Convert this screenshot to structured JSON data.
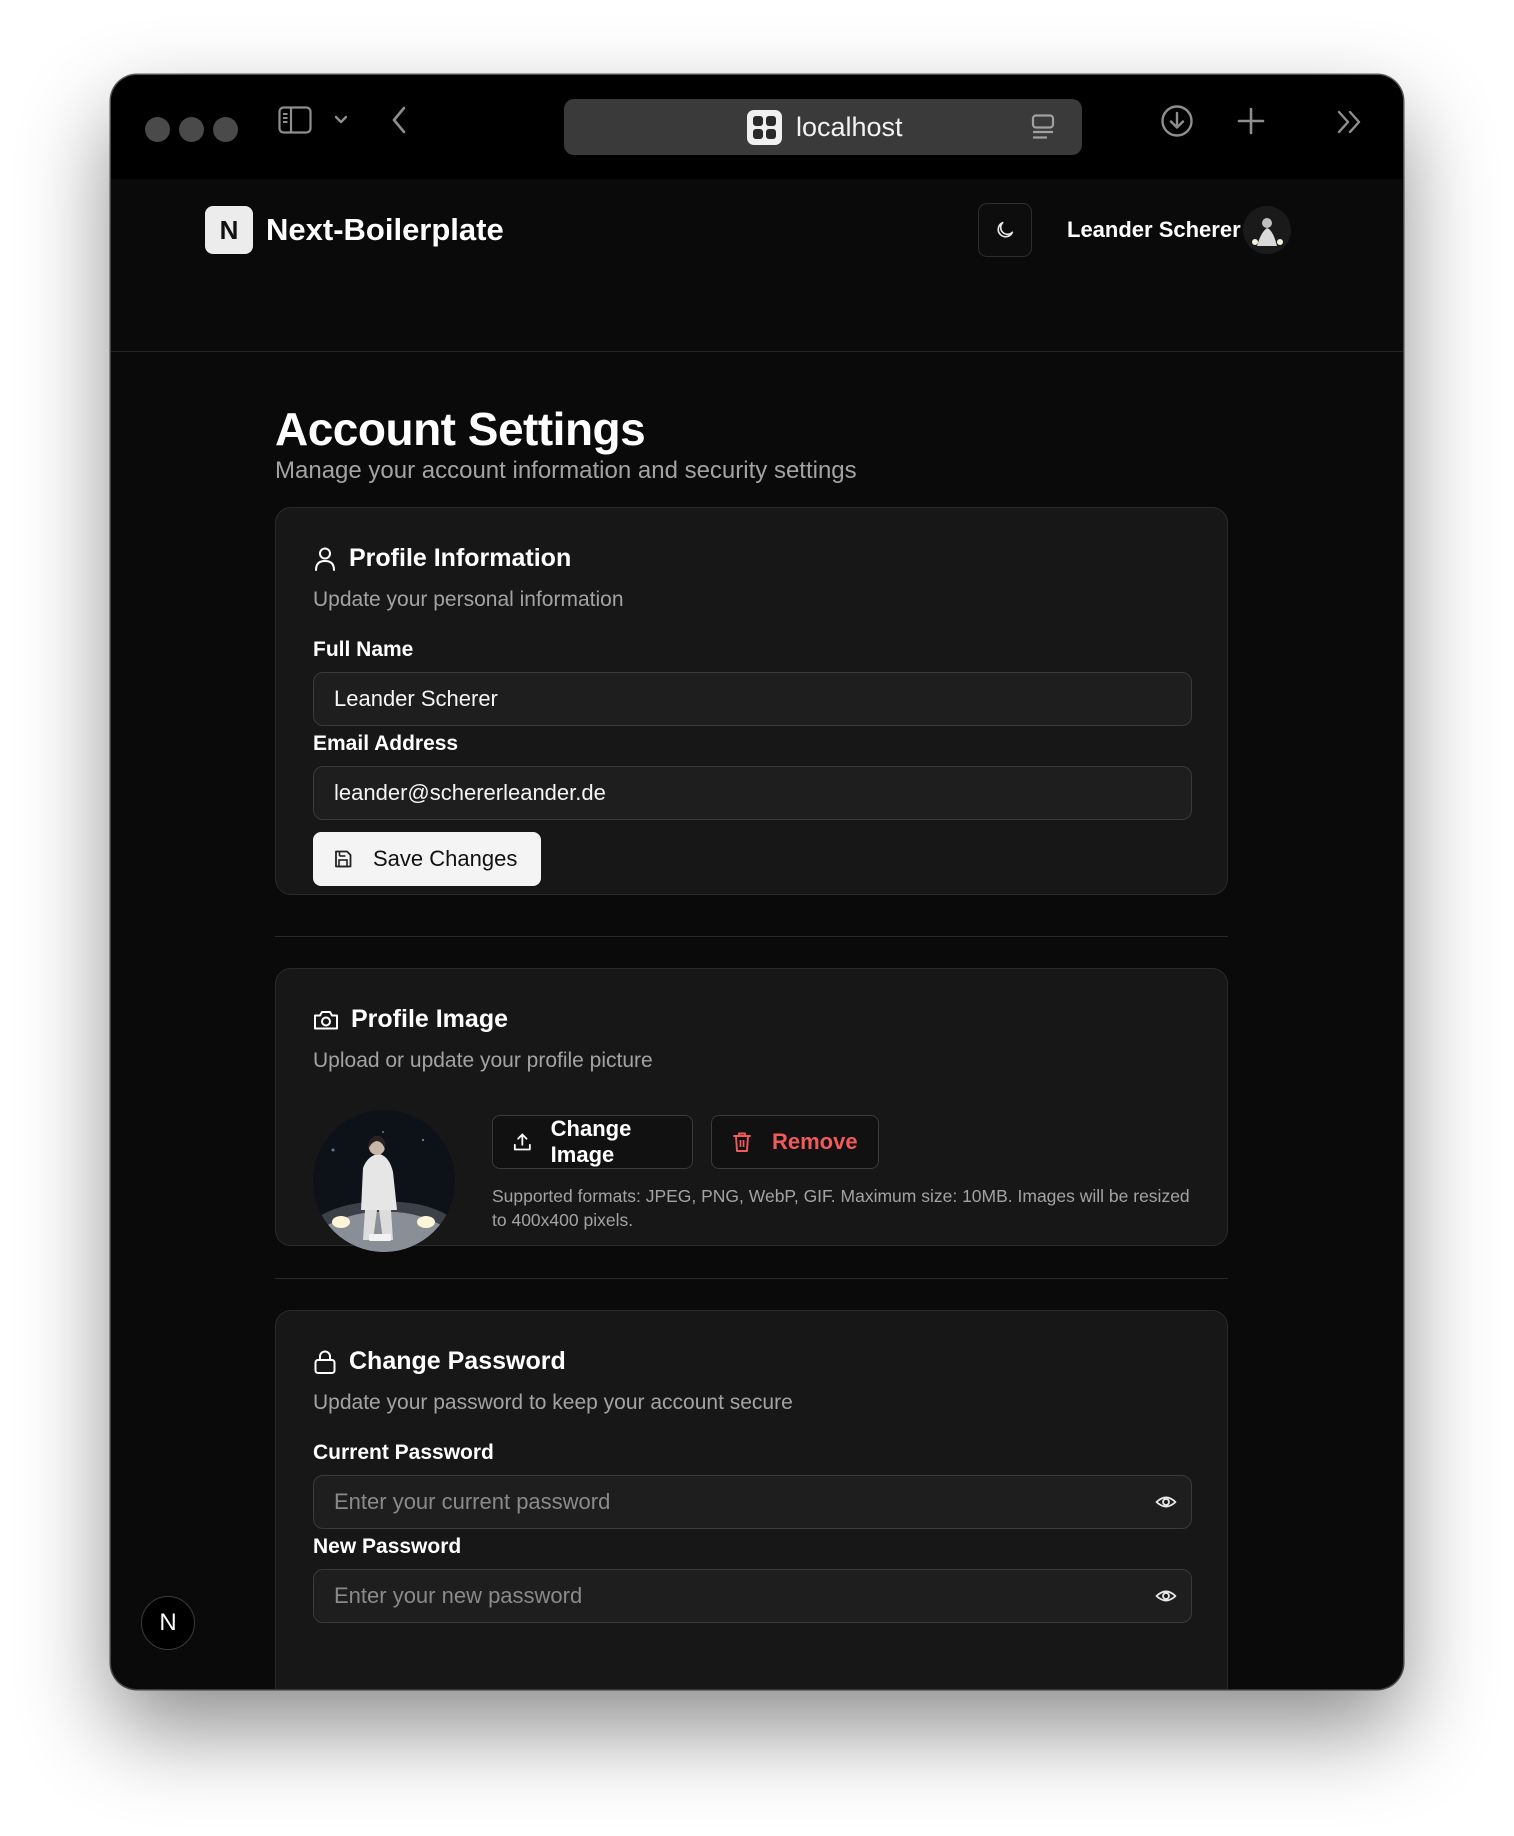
{
  "browser": {
    "url": "localhost",
    "traffic_lights": [
      "close",
      "minimize",
      "zoom"
    ],
    "icons": [
      "sidebar-icon",
      "chevron-down-icon",
      "back-icon",
      "reader-icon",
      "download-icon",
      "new-tab-icon",
      "overflow-icon"
    ]
  },
  "header": {
    "logo_letter": "N",
    "brand": "Next-Boilerplate",
    "user_name": "Leander Scherer"
  },
  "page": {
    "title": "Account Settings",
    "subtitle": "Manage your account information and security settings"
  },
  "profile": {
    "title": "Profile Information",
    "description": "Update your personal information",
    "full_name_label": "Full Name",
    "full_name_value": "Leander Scherer",
    "email_label": "Email Address",
    "email_value": "leander@schererleander.de",
    "save_label": "Save Changes"
  },
  "image": {
    "title": "Profile Image",
    "description": "Upload or update your profile picture",
    "change_label": "Change Image",
    "remove_label": "Remove",
    "hint": "Supported formats: JPEG, PNG, WebP, GIF. Maximum size: 10MB. Images will be resized to 400x400 pixels."
  },
  "password": {
    "title": "Change Password",
    "description": "Update your password to keep your account secure",
    "current_label": "Current Password",
    "current_placeholder": "Enter your current password",
    "new_label": "New Password",
    "new_placeholder": "Enter your new password"
  },
  "badge": {
    "letter": "N"
  },
  "colors": {
    "background": "#0a0a0a",
    "card": "#171717",
    "border": "#2a2a2a",
    "muted_text": "#a3a3a3",
    "danger": "#ef4444",
    "primary_button": "#f4f4f4"
  }
}
